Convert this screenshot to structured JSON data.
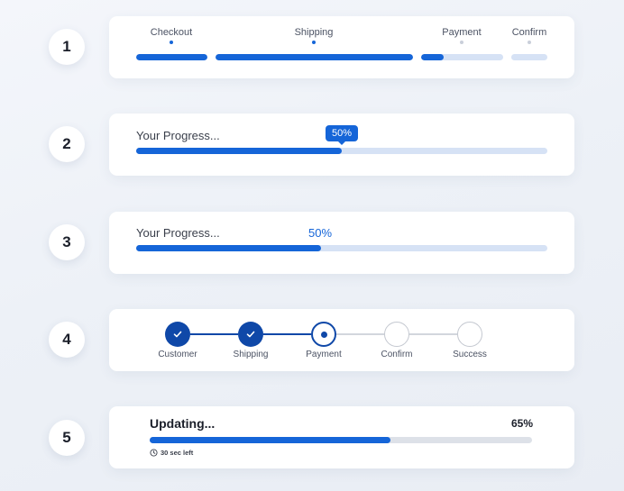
{
  "colors": {
    "accent": "#1565d8",
    "accent_dark": "#0f48a8",
    "track": "#d6e2f5",
    "track_gray": "#dde1e8",
    "inactive_border": "#c4c8d0"
  },
  "rows": [
    {
      "number": "1"
    },
    {
      "number": "2"
    },
    {
      "number": "3"
    },
    {
      "number": "4"
    },
    {
      "number": "5"
    }
  ],
  "row1": {
    "steps": [
      {
        "label": "Checkout",
        "state": "complete",
        "fill": 1.0
      },
      {
        "label": "Shipping",
        "state": "complete",
        "fill": 1.0
      },
      {
        "label": "Payment",
        "state": "partial",
        "fill": 0.27
      },
      {
        "label": "Confirm",
        "state": "upcoming",
        "fill": 0.0
      }
    ]
  },
  "row2": {
    "label": "Your Progress...",
    "percent_text": "50%",
    "progress": 0.5
  },
  "row3": {
    "label": "Your Progress...",
    "percent_text": "50%",
    "progress": 0.45
  },
  "row4": {
    "steps": [
      {
        "label": "Customer",
        "state": "done"
      },
      {
        "label": "Shipping",
        "state": "done"
      },
      {
        "label": "Payment",
        "state": "active"
      },
      {
        "label": "Confirm",
        "state": "todo"
      },
      {
        "label": "Success",
        "state": "todo"
      }
    ]
  },
  "row5": {
    "title": "Updating...",
    "percent_text": "65%",
    "progress": 0.63,
    "time_left": "30 sec left",
    "time_icon": "clock-icon"
  }
}
